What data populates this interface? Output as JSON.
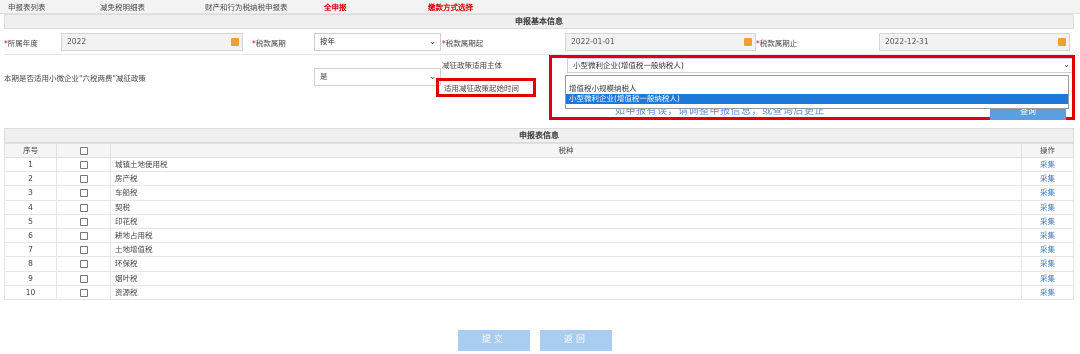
{
  "tabs": [
    "申报表列表",
    "减免税明细表",
    "财产和行为税纳税申报表",
    "全申报",
    "缴款方式选择"
  ],
  "basic_info": {
    "title": "申报基本信息",
    "year_label": "所属年度",
    "year_value": "2022",
    "period_label": "税款属期",
    "period_value": "按年",
    "start_label": "税款属期起",
    "start_value": "2022-01-01",
    "end_label": "税款属期止",
    "end_value": "2022-12-31",
    "policy_question_label": "本期是否适用小微企业\"六税两费\"减征政策",
    "policy_question_value": "是",
    "subject_label": "减征政策适用主体",
    "subject_value": "小型微利企业(增值税一般纳税人)",
    "start_time_label": "适用减征政策起始时间",
    "dropdown_options": [
      "增值税小规模纳税人",
      "小型微利企业(增值税一般纳税人)"
    ],
    "notice": "如申报有误，请调整申报信息，或查询后更正",
    "query_button": "查询"
  },
  "decl_info": {
    "title": "申报表信息",
    "headers": {
      "no": "序号",
      "tax": "税种",
      "op": "操作"
    },
    "rows": [
      {
        "no": "1",
        "tax": "城镇土地使用税",
        "op": "采集"
      },
      {
        "no": "2",
        "tax": "房产税",
        "op": "采集"
      },
      {
        "no": "3",
        "tax": "车船税",
        "op": "采集"
      },
      {
        "no": "4",
        "tax": "契税",
        "op": "采集"
      },
      {
        "no": "5",
        "tax": "印花税",
        "op": "采集"
      },
      {
        "no": "6",
        "tax": "耕地占用税",
        "op": "采集"
      },
      {
        "no": "7",
        "tax": "土地增值税",
        "op": "采集"
      },
      {
        "no": "8",
        "tax": "环保税",
        "op": "采集"
      },
      {
        "no": "9",
        "tax": "烟叶税",
        "op": "采集"
      },
      {
        "no": "10",
        "tax": "资源税",
        "op": "采集"
      }
    ]
  },
  "buttons": {
    "submit": "提交",
    "back": "返回"
  }
}
